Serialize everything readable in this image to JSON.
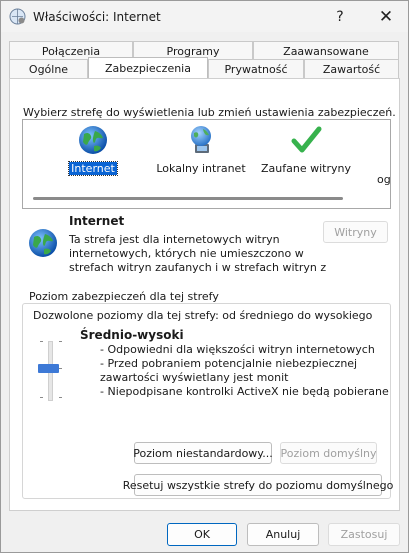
{
  "window": {
    "title": "Właściwości: Internet",
    "help_label": "?",
    "close_label": "✕"
  },
  "tabs": {
    "back_row": [
      "Połączenia",
      "Programy",
      "Zaawansowane"
    ],
    "front_row": [
      "Ogólne",
      "Zabezpieczenia",
      "Prywatność",
      "Zawartość"
    ],
    "active": "Zabezpieczenia"
  },
  "zones": {
    "instruction": "Wybierz strefę do wyświetlenia lub zmień ustawienia zabezpieczeń.",
    "items": [
      "Internet",
      "Lokalny intranet",
      "Zaufane witryny"
    ],
    "overflow_label": "og",
    "selected": "Internet"
  },
  "zone_info": {
    "title": "Internet",
    "description_lines": [
      "Ta strefa jest dla internetowych witryn",
      "internetowych, których nie umieszczono w",
      "strefach witryn zaufanych i w strefach witryn z"
    ],
    "sites_button": "Witryny"
  },
  "security_level": {
    "group_title": "Poziom zabezpieczeń dla tej strefy",
    "allowed_levels": "Dozwolone poziomy dla tej strefy: od średniego do wysokiego",
    "level_name": "Średnio-wysoki",
    "level_details": [
      "- Odpowiedni dla większości witryn internetowych",
      "- Przed pobraniem potencjalnie niebezpiecznej",
      "zawartości wyświetlany jest monit",
      "- Niepodpisane kontrolki ActiveX nie będą pobierane"
    ],
    "slider_level_fraction": 0.5,
    "custom_level_button": "Poziom niestandardowy...",
    "default_level_button": "Poziom domyślny",
    "reset_all_button": "Resetuj wszystkie strefy do poziomu domyślnego"
  },
  "footer": {
    "ok": "OK",
    "cancel": "Anuluj",
    "apply": "Zastosuj"
  },
  "colors": {
    "accent": "#0067c0",
    "selection": "#0a64d4",
    "slider_thumb": "#3d79d6"
  }
}
